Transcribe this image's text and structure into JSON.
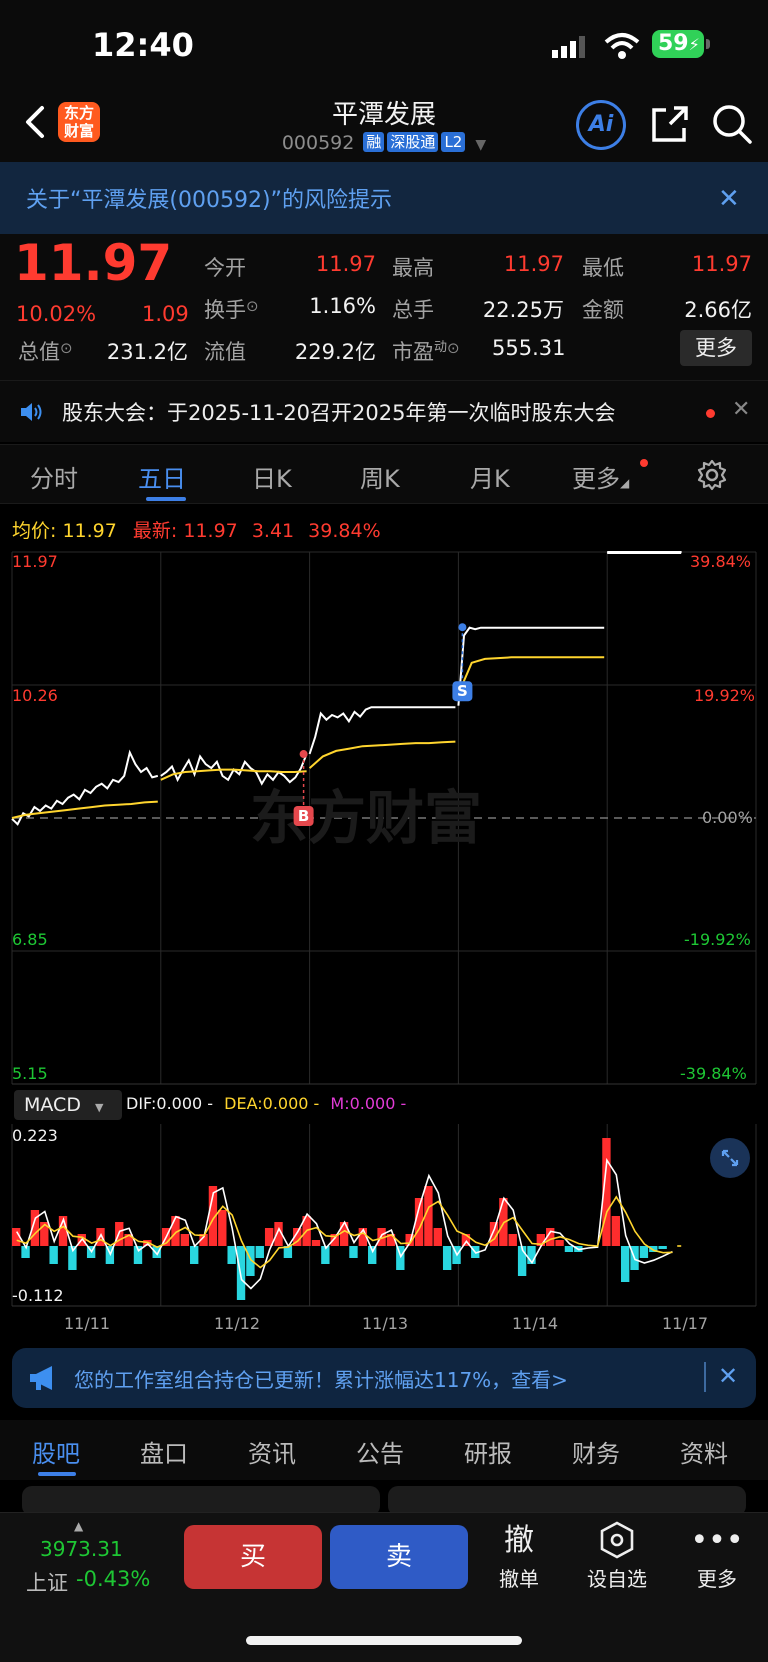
{
  "status_bar": {
    "time": "12:40",
    "battery": "59"
  },
  "header": {
    "logo_line1": "东方",
    "logo_line2": "财富",
    "name": "平潭发展",
    "code": "000592",
    "tags": [
      "融",
      "深股通",
      "L2"
    ],
    "ai_label": "Ai"
  },
  "risk_banner": {
    "text": "关于“平潭发展(000592)”的风险提示"
  },
  "quote": {
    "price": "11.97",
    "change_pct": "10.02%",
    "change": "1.09",
    "fields": {
      "open_label": "今开",
      "open": "11.97",
      "high_label": "最高",
      "high": "11.97",
      "low_label": "最低",
      "low": "11.97",
      "turnover_label": "换手",
      "turnover": "1.16%",
      "volume_label": "总手",
      "volume": "22.25万",
      "amount_label": "金额",
      "amount": "2.66亿",
      "mktcap_label": "总值",
      "mktcap": "231.2亿",
      "float_label": "流值",
      "float": "229.2亿",
      "pe_label": "市盈",
      "pe_sup": "动",
      "pe": "555.31"
    },
    "more_button": "更多"
  },
  "notice": {
    "text": "股东大会：于2025-11-20召开2025年第一次临时股东大会"
  },
  "tabs": {
    "items": [
      "分时",
      "五日",
      "日K",
      "周K",
      "月K",
      "更多"
    ],
    "active": "五日"
  },
  "summary": {
    "avg_label": "均价:",
    "avg_value": "11.97",
    "latest_label": "最新:",
    "latest_value": "11.97",
    "latest_change": "3.41",
    "latest_pct": "39.84%"
  },
  "chart_data": {
    "type": "line",
    "title": "",
    "y_left_ticks": [
      "11.97",
      "10.26",
      "",
      "6.85",
      "5.15"
    ],
    "y_right_ticks": [
      "39.84%",
      "19.92%",
      "0.00%",
      "-19.92%",
      "-39.84%"
    ],
    "x_ticks": [
      "11/11",
      "11/12",
      "11/13",
      "11/14",
      "11/17"
    ],
    "ylim": [
      5.15,
      11.97
    ],
    "prev_close": 8.56,
    "series": [
      {
        "name": "",
        "color": "#ffffff",
        "days": [
          [
            8.55,
            8.48,
            8.62,
            8.58,
            8.7,
            8.65,
            8.72,
            8.68,
            8.78,
            8.74,
            8.82,
            8.86,
            8.8,
            8.92,
            8.88,
            8.96,
            9.0,
            8.94,
            9.05,
            9.02,
            9.1,
            9.4,
            9.25,
            9.15,
            9.2,
            9.08,
            9.1
          ],
          [
            9.1,
            9.15,
            9.22,
            9.05,
            9.18,
            9.3,
            9.12,
            9.35,
            9.25,
            9.2,
            9.28,
            9.1,
            9.05,
            9.18,
            9.12,
            9.28,
            9.2,
            9.15,
            9.0,
            9.12,
            9.05,
            9.15,
            9.1,
            9.02,
            9.08,
            9.2,
            9.38
          ],
          [
            9.38,
            9.6,
            9.9,
            9.82,
            9.88,
            9.85,
            9.9,
            9.8,
            9.92,
            9.86,
            9.95,
            9.98,
            9.98,
            9.98,
            9.98,
            9.98,
            9.98,
            9.98,
            9.98,
            9.98,
            9.98,
            9.98,
            9.98,
            9.98,
            9.98,
            9.98,
            9.98
          ],
          [
            10.0,
            10.9,
            11.0,
            10.98,
            11.0,
            11.0,
            11.0,
            11.0,
            11.0,
            11.0,
            11.0,
            11.0,
            11.0,
            11.0,
            11.0,
            11.0,
            11.0,
            11.0,
            11.0,
            11.0,
            11.0,
            11.0,
            11.0,
            11.0,
            11.0,
            11.0,
            11.0
          ],
          [
            11.97,
            11.97
          ]
        ]
      },
      {
        "name": "",
        "color": "#ffd52e",
        "days": [
          [
            8.56,
            8.6,
            8.62,
            8.64,
            8.66,
            8.68,
            8.7,
            8.72,
            8.73,
            8.74,
            8.76,
            8.77
          ],
          [
            9.05,
            9.12,
            9.15,
            9.16,
            9.17,
            9.18,
            9.18,
            9.17,
            9.16,
            9.16,
            9.15,
            9.15,
            9.16
          ],
          [
            9.2,
            9.35,
            9.42,
            9.45,
            9.48,
            9.49,
            9.5,
            9.51,
            9.52,
            9.52,
            9.53,
            9.54
          ],
          [
            10.15,
            10.55,
            10.6,
            10.61,
            10.62,
            10.62,
            10.62,
            10.62,
            10.62,
            10.62,
            10.62,
            10.62
          ]
        ]
      }
    ],
    "markers": [
      {
        "label": "B",
        "day": 2,
        "value": 9.38,
        "color": "#e5484d"
      },
      {
        "label": "S",
        "day": 3,
        "value": 10.16,
        "color": "#3d7fe6"
      }
    ],
    "watermark": "东方财富"
  },
  "macd": {
    "selector": "MACD",
    "dif_label": "DIF:0.000",
    "dea_label": "DEA:0.000",
    "m_label": "M:0.000",
    "ymax": "0.223",
    "ymin": "-0.112",
    "bars": [
      0.03,
      -0.02,
      0.06,
      0.04,
      -0.03,
      0.05,
      -0.04,
      0.02,
      -0.02,
      0.03,
      -0.03,
      0.04,
      0.02,
      -0.03,
      0.01,
      -0.02,
      0.03,
      0.05,
      0.02,
      -0.03,
      0.02,
      0.1,
      0.06,
      -0.03,
      -0.09,
      -0.05,
      -0.02,
      0.03,
      0.04,
      -0.02,
      0.03,
      0.05,
      0.01,
      -0.03,
      0.02,
      0.04,
      -0.02,
      0.03,
      -0.03,
      0.03,
      0.02,
      -0.04,
      0.02,
      0.08,
      0.1,
      0.03,
      -0.04,
      -0.03,
      0.02,
      -0.02,
      0.0,
      0.04,
      0.08,
      0.02,
      -0.05,
      -0.03,
      0.02,
      0.03,
      0.01,
      -0.01,
      -0.01,
      0.0,
      0.0,
      0.18,
      0.05,
      -0.06,
      -0.04,
      -0.02,
      -0.01,
      -0.005,
      0.0
    ]
  },
  "portfolio_banner": {
    "text": "您的工作室组合持仓已更新！累计涨幅达117%，查看>"
  },
  "bottom_tabs": {
    "items": [
      "股吧",
      "盘口",
      "资讯",
      "公告",
      "研报",
      "财务",
      "资料"
    ],
    "active": "股吧"
  },
  "action_bar": {
    "index_value": "3973.31",
    "index_name": "上证",
    "index_pct": "-0.43%",
    "buy": "买",
    "sell": "卖",
    "cancel_icon": "撤",
    "cancel": "撤单",
    "watch": "设自选",
    "more": "更多"
  }
}
